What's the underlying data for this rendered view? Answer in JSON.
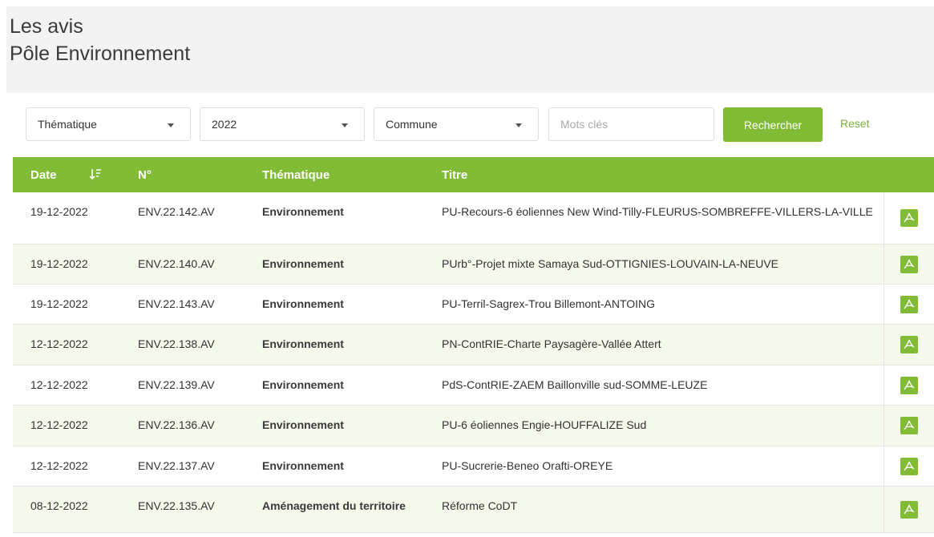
{
  "header": {
    "line1": "Les avis",
    "line2": "Pôle Environnement"
  },
  "filters": {
    "thematique": "Thématique",
    "annee": "2022",
    "commune": "Commune",
    "mots_cles_placeholder": "Mots clés",
    "search_label": "Rechercher",
    "reset_label": "Reset"
  },
  "table": {
    "columns": {
      "date": "Date",
      "num": "N°",
      "thematique": "Thématique",
      "titre": "Titre"
    },
    "rows": [
      {
        "date": "19-12-2022",
        "num": "ENV.22.142.AV",
        "theme": "Environnement",
        "title": "PU-Recours-6 éoliennes New Wind-Tilly-FLEURUS-SOMBREFFE-VILLERS-LA-VILLE"
      },
      {
        "date": "19-12-2022",
        "num": "ENV.22.140.AV",
        "theme": "Environnement",
        "title": "PUrb°-Projet mixte Samaya Sud-OTTIGNIES-LOUVAIN-LA-NEUVE"
      },
      {
        "date": "19-12-2022",
        "num": "ENV.22.143.AV",
        "theme": "Environnement",
        "title": "PU-Terril-Sagrex-Trou Billemont-ANTOING"
      },
      {
        "date": "12-12-2022",
        "num": "ENV.22.138.AV",
        "theme": "Environnement",
        "title": "PN-ContRIE-Charte Paysagère-Vallée Attert"
      },
      {
        "date": "12-12-2022",
        "num": "ENV.22.139.AV",
        "theme": "Environnement",
        "title": "PdS-ContRIE-ZAEM Baillonville sud-SOMME-LEUZE"
      },
      {
        "date": "12-12-2022",
        "num": "ENV.22.136.AV",
        "theme": "Environnement",
        "title": "PU-6 éoliennes Engie-HOUFFALIZE Sud"
      },
      {
        "date": "12-12-2022",
        "num": "ENV.22.137.AV",
        "theme": "Environnement",
        "title": "PU-Sucrerie-Beneo Orafti-OREYE"
      },
      {
        "date": "08-12-2022",
        "num": "ENV.22.135.AV",
        "theme": "Aménagement du territoire",
        "title": "Réforme CoDT"
      }
    ]
  },
  "colors": {
    "accent": "#82bc37",
    "row_alt": "#f4f9ec"
  }
}
